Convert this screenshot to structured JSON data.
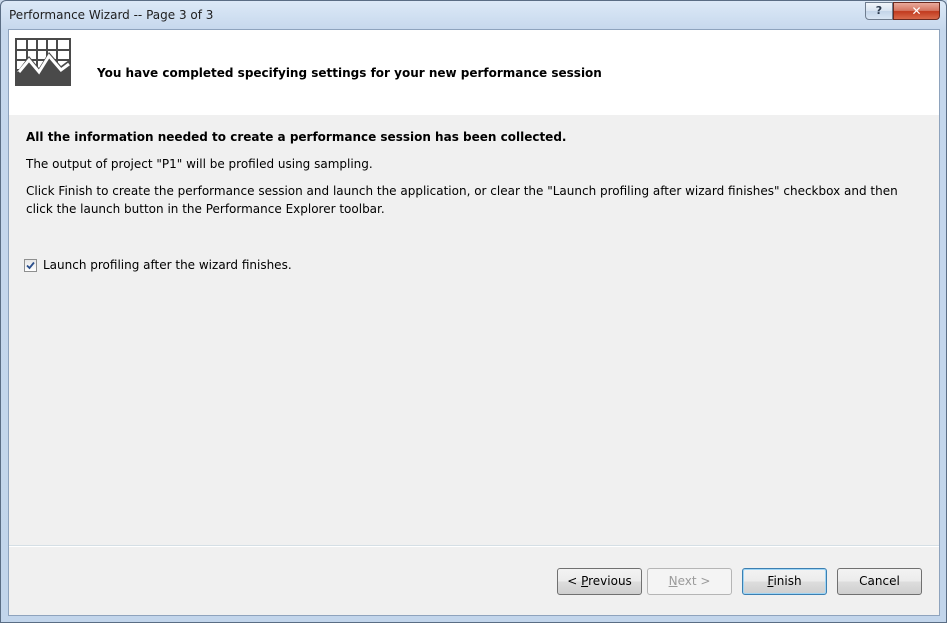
{
  "window": {
    "title": "Performance Wizard -- Page 3 of 3",
    "help_label": "?",
    "close_label": "✕"
  },
  "banner": {
    "icon": "performance-chart-icon",
    "title": "You have completed specifying settings for your new performance session"
  },
  "body": {
    "heading": "All the information needed to create a performance session has been collected.",
    "output_text": "The output of project  \"P1\" will be profiled using sampling.",
    "instructions": "Click Finish to create the performance session and launch the application, or clear the \"Launch profiling after wizard finishes\" checkbox and then click the launch button in the Performance Explorer toolbar.",
    "launch_checkbox": {
      "label": "Launch profiling after the wizard finishes.",
      "checked": true
    }
  },
  "buttons": {
    "previous": {
      "prefix": "< ",
      "mnemonic": "P",
      "rest": "revious"
    },
    "next": {
      "mnemonic": "N",
      "rest": "ext >",
      "disabled": true
    },
    "finish": {
      "mnemonic": "F",
      "rest": "inish"
    },
    "cancel": {
      "label": "Cancel"
    }
  }
}
